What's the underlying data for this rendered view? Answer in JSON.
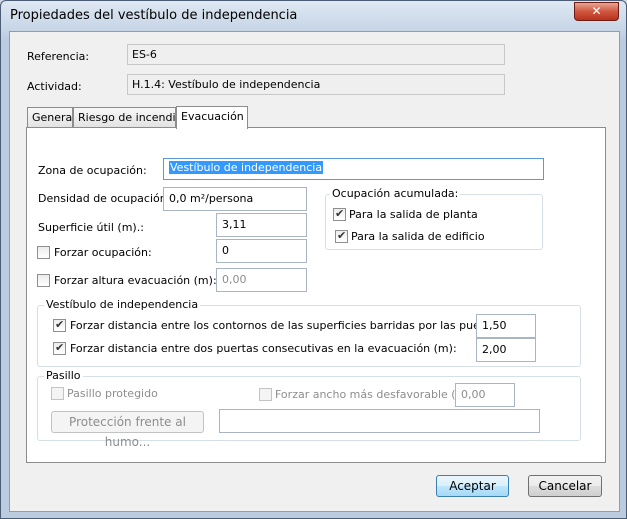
{
  "window": {
    "title": "Propiedades del vestíbulo de independencia",
    "close_glyph": "✕"
  },
  "header": {
    "referencia_label": "Referencia:",
    "referencia_value": "ES-6",
    "actividad_label": "Actividad:",
    "actividad_value": "H.1.4: Vestíbulo de independencia"
  },
  "tabs": [
    {
      "label": "General"
    },
    {
      "label": "Riesgo de incendio"
    },
    {
      "label": "Evacuación"
    }
  ],
  "evacuacion": {
    "zona_label": "Zona de ocupación:",
    "zona_value": "Vestíbulo de independencia",
    "densidad_label": "Densidad de ocupación:",
    "densidad_value": "0,0 m²/persona",
    "superficie_label": "Superficie útil (m).:",
    "superficie_value": "3,11",
    "forzar_ocupacion_label": "Forzar ocupación:",
    "forzar_ocupacion_value": "0",
    "forzar_altura_label": "Forzar altura evacuación (m):",
    "forzar_altura_value": "0,00",
    "ocupacion_acumulada": {
      "title": "Ocupación acumulada:",
      "salida_planta": "Para la salida de planta",
      "salida_edificio": "Para la salida de edificio"
    },
    "vestibulo": {
      "title": "Vestíbulo de independencia",
      "contornos_label": "Forzar distancia entre los contornos de las superficies barridas por las puertas (m):",
      "contornos_value": "1,50",
      "puertas_label": "Forzar distancia entre dos puertas  consecutivas en la evacuación (m):",
      "puertas_value": "2,00"
    },
    "pasillo": {
      "title": "Pasillo",
      "protegido_label": "Pasillo protegido",
      "ancho_label": "Forzar ancho más desfavorable (m):",
      "ancho_value": "0,00",
      "humo_button": "Protección frente al humo..."
    }
  },
  "buttons": {
    "aceptar": "Aceptar",
    "cancelar": "Cancelar"
  }
}
